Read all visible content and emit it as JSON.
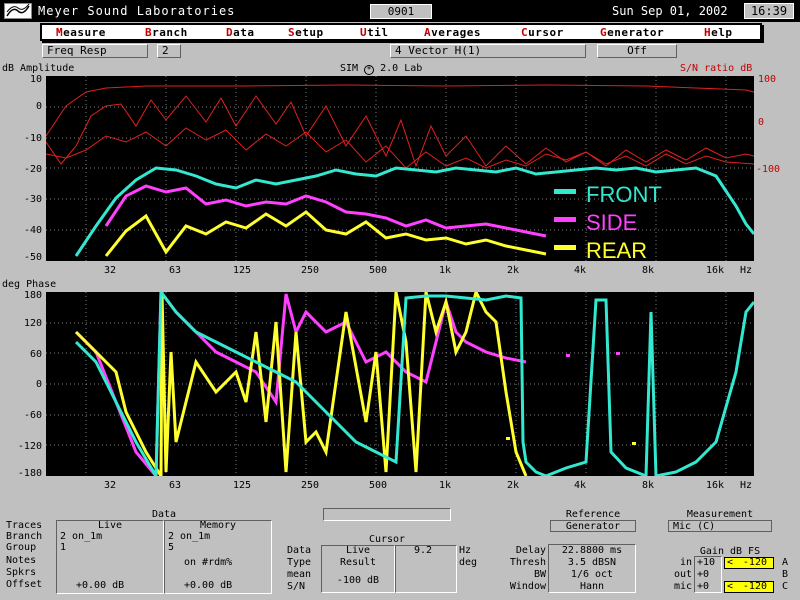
{
  "window": {
    "title": "Meyer Sound Laboratories",
    "doc_number": "0901",
    "date": "Sun Sep 01, 2002",
    "time": "16:39"
  },
  "menu": [
    {
      "key": "M",
      "rest": "easure"
    },
    {
      "key": "B",
      "rest": "ranch"
    },
    {
      "key": "D",
      "rest": "ata"
    },
    {
      "key": "S",
      "rest": "etup"
    },
    {
      "key": "U",
      "rest": "til"
    },
    {
      "key": "A",
      "rest": "verages"
    },
    {
      "key": "C",
      "rest": "ursor"
    },
    {
      "key": "G",
      "rest": "enerator"
    },
    {
      "key": "H",
      "rest": "elp"
    }
  ],
  "subrow": {
    "mode": "Freq Resp",
    "branch": "2",
    "vector": "4  Vector H(1)",
    "generator": "Off"
  },
  "amplitude_panel": {
    "left_label": "dB Amplitude",
    "center_label": "SIM",
    "center_label_suffix": "2.0 Lab",
    "right_label": "S/N ratio dB",
    "y_ticks": [
      "10",
      "0",
      "-10",
      "-20",
      "-30",
      "-40",
      "-50"
    ],
    "right_ticks": [
      "100",
      "0",
      "-100"
    ],
    "legend": [
      {
        "label": "FRONT",
        "color": "#33e8d0"
      },
      {
        "label": "SIDE",
        "color": "#ff40ff"
      },
      {
        "label": "REAR",
        "color": "#ffff30"
      }
    ]
  },
  "phase_panel": {
    "left_label": "deg Phase",
    "y_ticks": [
      "180",
      "120",
      "60",
      "0",
      "-60",
      "-120",
      "-180"
    ]
  },
  "x_ticks": [
    "32",
    "63",
    "125",
    "250",
    "500",
    "1k",
    "2k",
    "4k",
    "8k",
    "16k",
    "Hz"
  ],
  "data_panel": {
    "title": "Data",
    "live_header": "Live",
    "memory_header": "Memory",
    "rows": [
      {
        "label": "Traces",
        "live": "",
        "memory": ""
      },
      {
        "label": "Branch",
        "live": "2  on_1m",
        "memory": "2  on_1m"
      },
      {
        "label": "Group",
        "live": "1",
        "memory": "5"
      },
      {
        "label": "Notes",
        "live": "",
        "memory": ""
      },
      {
        "label": "Spkrs",
        "live": "",
        "memory": "on #rdm%"
      },
      {
        "label": "Offset",
        "live": "+0.00 dB",
        "memory": "+0.00 dB"
      }
    ]
  },
  "cursor_panel": {
    "title": "Cursor",
    "rows": [
      "Data",
      "Type",
      "mean",
      "S/N"
    ],
    "live": "Live",
    "result": "Result",
    "result_value": "-100 dB",
    "freq": "9.2",
    "freq_unit": "Hz",
    "deg_unit": "deg"
  },
  "reference_panel": {
    "title": "Reference",
    "value": "Generator",
    "rows": [
      {
        "label": "Delay",
        "value": "22.8800 ms"
      },
      {
        "label": "Thresh",
        "value": "3.5 dBSN"
      },
      {
        "label": "BW",
        "value": "1/6 oct"
      },
      {
        "label": "Window",
        "value": "Hann"
      }
    ]
  },
  "measurement_panel": {
    "title": "Measurement",
    "value": "Mic (C)"
  },
  "gain_panel": {
    "title": "Gain dB FS",
    "rows": [
      {
        "label": "in",
        "value": "+10",
        "meter": "-120",
        "ch": "A"
      },
      {
        "label": "out",
        "value": "+0",
        "meter": "",
        "ch": "B"
      },
      {
        "label": "mic",
        "value": "+0",
        "meter": "-120",
        "ch": "C"
      }
    ]
  }
}
